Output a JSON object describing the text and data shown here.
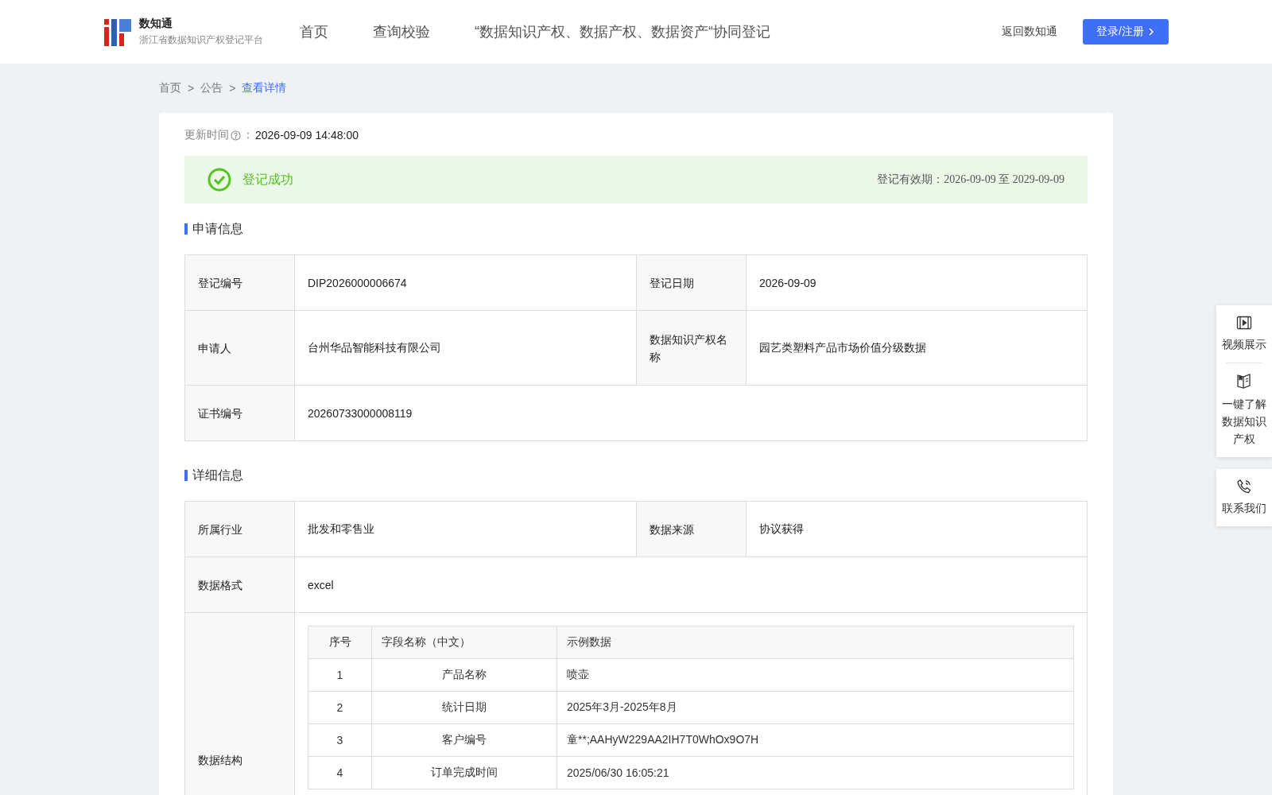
{
  "header": {
    "logo_title": "数知通",
    "logo_subtitle": "浙江省数据知识产权登记平台",
    "nav": [
      {
        "label": "首页",
        "selected": false
      },
      {
        "label": "查询校验",
        "selected": false
      },
      {
        "label": "“数据知识产权、数据产权、数据资产“协同登记",
        "selected": false
      }
    ],
    "back_link": "返回数知通",
    "login_button": "登录/注册"
  },
  "breadcrumb": [
    {
      "label": "首页",
      "selected": false
    },
    {
      "label": "公告",
      "selected": false
    },
    {
      "label": "查看详情",
      "selected": true
    }
  ],
  "breadcrumb_separator": ">",
  "update": {
    "label": "更新时间",
    "colon": "：",
    "value": "2026-09-09 14:48:00"
  },
  "status": {
    "kind": "success",
    "text": "登记成功",
    "validity": "登记有效期：2026-09-09 至 2029-09-09"
  },
  "application": {
    "title": "申请信息",
    "rows": [
      {
        "cells": [
          {
            "label": "登记编号",
            "value": "DIP2026000006674"
          },
          {
            "label": "登记日期",
            "value": "2026-09-09"
          }
        ]
      },
      {
        "cells": [
          {
            "label": "申请人",
            "value": "台州华品智能科技有限公司"
          },
          {
            "label": "数据知识产权名称",
            "value": "园艺类塑料产品市场价值分级数据"
          }
        ]
      },
      {
        "cells": [
          {
            "label": "证书编号",
            "value": "20260733000008119"
          }
        ]
      }
    ]
  },
  "details": {
    "title": "详细信息",
    "rows": [
      {
        "cells": [
          {
            "label": "所属行业",
            "value": "批发和零售业"
          },
          {
            "label": "数据来源",
            "value": "协议获得"
          }
        ]
      },
      {
        "cells": [
          {
            "label": "数据格式",
            "value": "excel"
          }
        ]
      }
    ],
    "structure": {
      "label": "数据结构",
      "columns": [
        "序号",
        "字段名称（中文）",
        "示例数据"
      ],
      "rows": [
        [
          "1",
          "产品名称",
          "喷壶"
        ],
        [
          "2",
          "统计日期",
          "2025年3月-2025年8月"
        ],
        [
          "3",
          "客户编号",
          "童**;AAHyW229AA2IH7T0WhOx9O7H"
        ],
        [
          "4",
          "订单完成时间",
          "2025/06/30 16:05:21"
        ]
      ]
    }
  },
  "side_panel": [
    {
      "kind": "video",
      "label": "视频展示"
    },
    {
      "kind": "book",
      "label": "一键了解数据知识产权"
    },
    {
      "kind": "phone",
      "label": "联系我们"
    }
  ]
}
